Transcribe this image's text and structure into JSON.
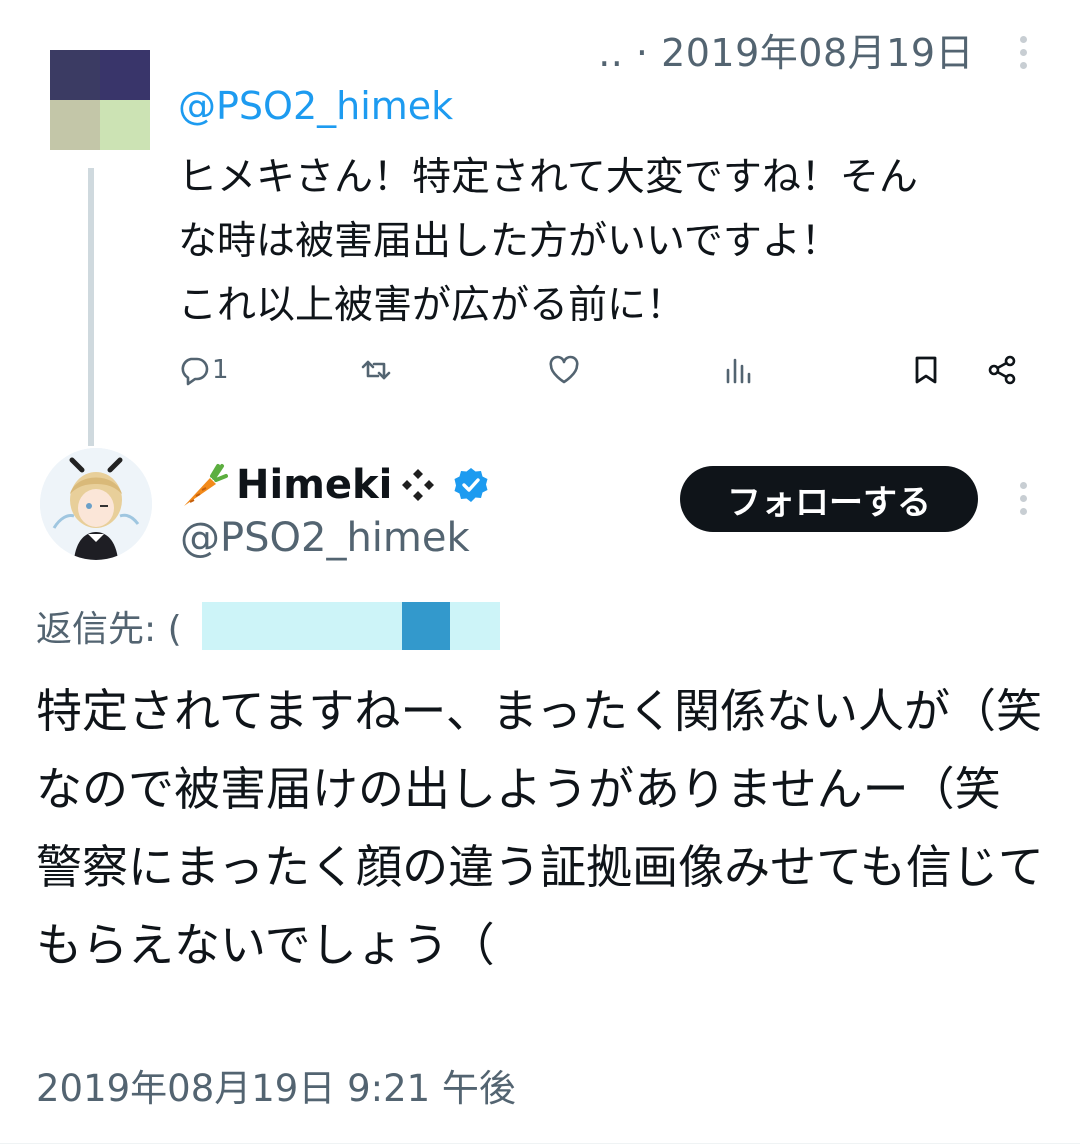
{
  "parent": {
    "meta": ".. · 2019年08月19日",
    "handle": "@PSO2_himek",
    "text": "ヒメキさん！特定されて大変ですね！そん\nな時は被害届出した方がいいですよ！\nこれ以上被害が広がる前に！",
    "avatar_colors": [
      "#3b3b63",
      "#39356a",
      "#c3c6a8",
      "#cce3b4"
    ],
    "actions": {
      "reply_count": "1",
      "reply_icon": "reply-icon",
      "retweet_icon": "retweet-icon",
      "like_icon": "heart-icon",
      "views_icon": "views-icon",
      "bookmark_icon": "bookmark-icon",
      "share_icon": "share-icon"
    }
  },
  "main": {
    "display_name": "Himeki",
    "name_emoji_left": "carrot-icon",
    "name_emoji_right": "diamond-cluster-icon",
    "verified_badge": "verified-badge-icon",
    "handle": "@PSO2_himek",
    "follow_label": "フォローする",
    "reply_to_label": "返信先: (",
    "text": "特定されてますねー、まったく関係ない人が（笑　なので被害届けの出しようがありませんー（笑　警察にまったく顔の違う証拠画像みせても信じてもらえないでしょう（",
    "timestamp": "2019年08月19日 9:21 午後"
  },
  "colors": {
    "accent": "#1d9bf0",
    "text_primary": "#0f1419",
    "text_secondary": "#536471",
    "follow_button_bg": "#0f1419",
    "redaction_light": "#cdf4f8",
    "redaction_dark": "#3399cc"
  }
}
